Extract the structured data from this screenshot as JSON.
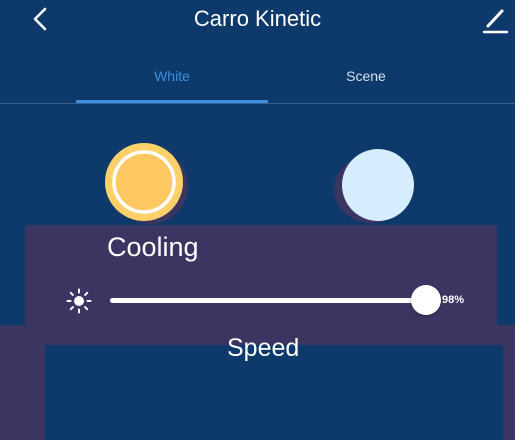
{
  "header": {
    "title": "Carro Kinetic",
    "back_icon": "chevron-left-icon",
    "edit_icon": "pencil-icon"
  },
  "tabs": [
    {
      "label": "White",
      "active": true
    },
    {
      "label": "Scene",
      "active": false
    }
  ],
  "swatches": {
    "warm_color": "#fdd06a",
    "cool_color": "#d5edff"
  },
  "overlay": {
    "cooling_label": "Cooling",
    "speed_label": "Speed"
  },
  "brightness": {
    "icon": "sun-icon",
    "value": 98,
    "value_text": "98%"
  },
  "colors": {
    "background": "#0d3a6a",
    "accent": "#3d8fe0",
    "overlay": "#3b3562"
  }
}
